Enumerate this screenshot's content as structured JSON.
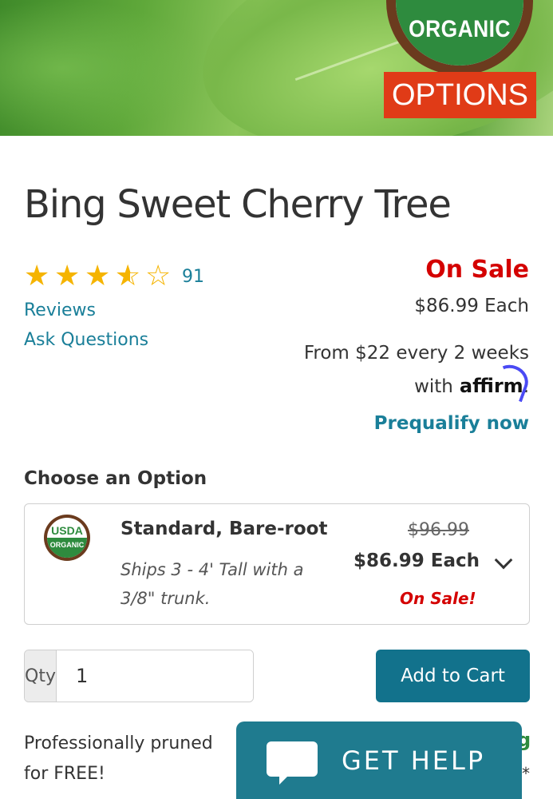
{
  "hero": {
    "seal_text": "ORGANIC",
    "options_label": "OPTIONS"
  },
  "product": {
    "title": "Bing Sweet Cherry Tree",
    "rating": 3.5,
    "rating_max": 5,
    "review_count": "91",
    "reviews_link": "Reviews",
    "ask_link": "Ask Questions",
    "sale_label": "On Sale",
    "price_each": "$86.99 Each",
    "financing_line1": "From $22 every 2 weeks",
    "financing_with": "with",
    "affirm_brand": "affirm",
    "affirm_period": ".",
    "prequalify": "Prequalify now"
  },
  "options": {
    "heading": "Choose an Option",
    "selected": {
      "badge_top": "USDA",
      "badge_bottom": "ORGANIC",
      "name": "Standard, Bare-root",
      "description": "Ships 3 - 4' Tall with a 3/8\" trunk.",
      "old_price": "$96.99",
      "new_price": "$86.99 Each",
      "sale_note": "On Sale!"
    }
  },
  "cart": {
    "qty_label": "Qty",
    "qty_value": "1",
    "add_button": "Add to Cart"
  },
  "footer": {
    "pruned_text": "Professionally pruned for FREE!",
    "partial_g": "g",
    "asterisk": "*",
    "help_label": "GET HELP"
  },
  "colors": {
    "link": "#1a7f99",
    "sale_red": "#d40000",
    "button_teal": "#12728c",
    "help_teal": "#1f7b8f",
    "star_gold": "#f5b400"
  }
}
